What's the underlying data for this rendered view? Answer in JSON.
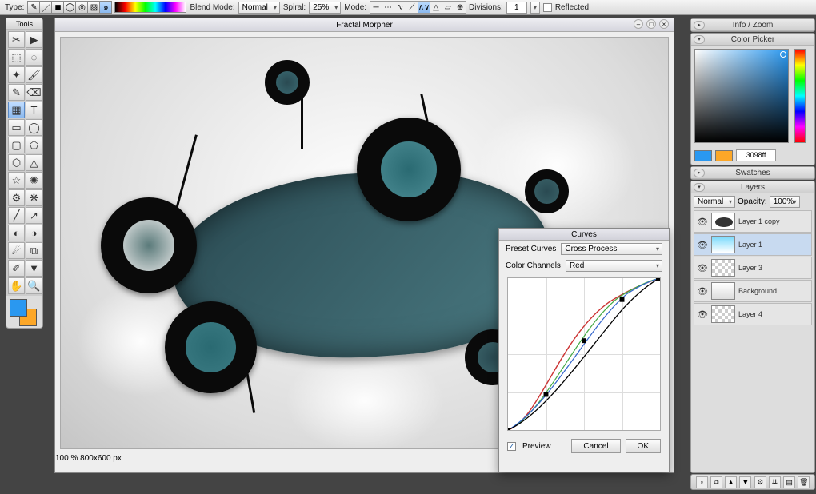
{
  "topbar": {
    "type_label": "Type:",
    "blend_label": "Blend Mode:",
    "blend_value": "Normal",
    "spiral_label": "Spiral:",
    "spiral_value": "25%",
    "mode_label": "Mode:",
    "divisions_label": "Divisions:",
    "divisions_value": "1",
    "reflected_label": "Reflected"
  },
  "tools": {
    "title": "Tools"
  },
  "canvas": {
    "title": "Fractal Morpher",
    "zoom": "100 %",
    "dims": "800x600 px"
  },
  "curves": {
    "title": "Curves",
    "preset_label": "Preset Curves",
    "preset_value": "Cross Process",
    "channel_label": "Color Channels",
    "channel_value": "Red",
    "preview_label": "Preview",
    "cancel": "Cancel",
    "ok": "OK"
  },
  "panels": {
    "infozoom": "Info / Zoom",
    "colorpicker": "Color Picker",
    "swatches": "Swatches",
    "layers": "Layers"
  },
  "picker": {
    "hex": "3098ff",
    "fg": "#2a98f0",
    "bg": "#fca728"
  },
  "layers": {
    "mode_value": "Normal",
    "opacity_label": "Opacity:",
    "opacity_value": "100%",
    "items": [
      {
        "name": "Layer 1 copy"
      },
      {
        "name": "Layer 1"
      },
      {
        "name": "Layer 3"
      },
      {
        "name": "Background"
      },
      {
        "name": "Layer 4"
      }
    ]
  }
}
